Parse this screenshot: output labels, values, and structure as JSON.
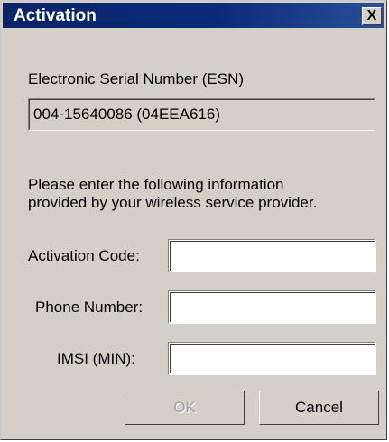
{
  "window": {
    "title": "Activation",
    "close_glyph": "X"
  },
  "esn": {
    "label": "Electronic Serial Number (ESN)",
    "value": "004-15640086 (04EEA616)"
  },
  "instructions": {
    "line1": "Please enter the following information",
    "line2": "provided by your wireless service provider."
  },
  "fields": {
    "activation_code": {
      "label": "Activation Code:",
      "value": ""
    },
    "phone_number": {
      "label": "Phone Number:",
      "value": ""
    },
    "imsi": {
      "label": "IMSI (MIN):",
      "value": ""
    }
  },
  "buttons": {
    "ok": "OK",
    "cancel": "Cancel"
  }
}
